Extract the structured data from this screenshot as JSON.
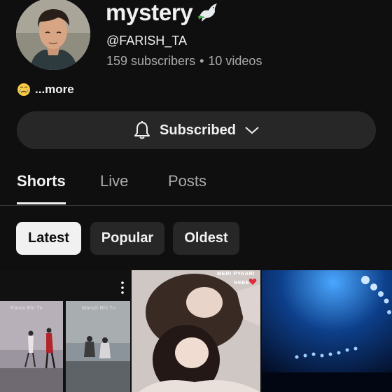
{
  "channel": {
    "name": "mystery",
    "name_emoji": "dove-icon",
    "handle": "@FARISH_TA",
    "subscribers": "159 subscribers",
    "separator": "•",
    "videos": "10 videos"
  },
  "description": {
    "emoji": "crying-face-icon",
    "more_label": "...more"
  },
  "subscribe": {
    "label": "Subscribed",
    "icon": "bell-icon",
    "dropdown_icon": "chevron-down-icon"
  },
  "tabs": [
    {
      "label": "Shorts",
      "active": true
    },
    {
      "label": "Live",
      "active": false
    },
    {
      "label": "Posts",
      "active": false
    }
  ],
  "filters": [
    {
      "label": "Latest",
      "active": true
    },
    {
      "label": "Popular",
      "active": false
    },
    {
      "label": "Oldest",
      "active": false
    }
  ],
  "shorts": [
    {
      "captions": [
        "Rasta Bhi Tu",
        "Manzil Bhi Tu"
      ]
    },
    {
      "overlay": [
        "MERI PYAARI",
        "NEEE"
      ]
    },
    {}
  ],
  "colors": {
    "background": "#0f0f0f",
    "surface": "#272727",
    "text_primary": "#f1f1f1",
    "text_secondary": "#aaaaaa",
    "active_chip": "#f1f1f1"
  }
}
